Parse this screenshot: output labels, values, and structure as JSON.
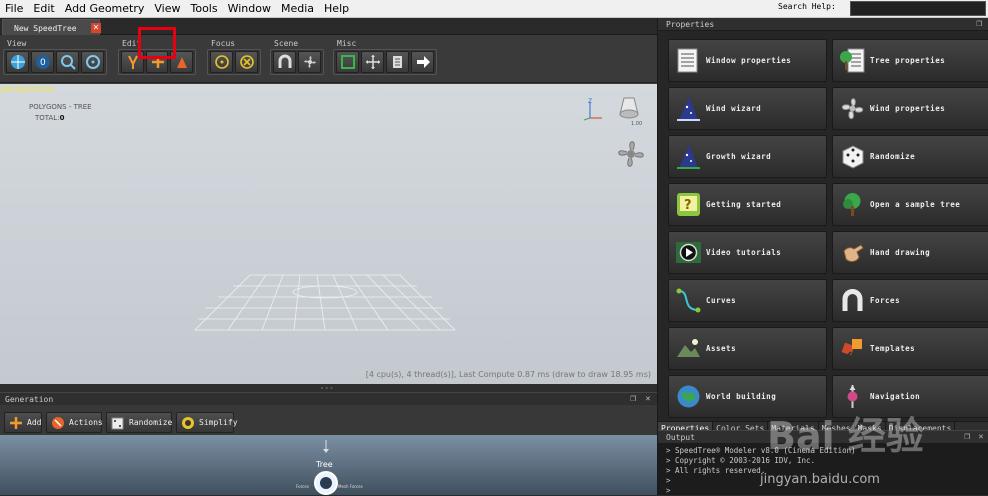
{
  "menu": [
    "File",
    "Edit",
    "Add Geometry",
    "View",
    "Tools",
    "Window",
    "Media",
    "Help"
  ],
  "search_help": {
    "label": "Search Help:",
    "value": ""
  },
  "document_tab": {
    "title": "New SpeedTree",
    "close": "✕"
  },
  "toolbar": {
    "groups": [
      {
        "label": "View",
        "buttons": [
          "globe-icon",
          "zero-icon",
          "zoom-icon",
          "target-icon"
        ]
      },
      {
        "label": "Edit",
        "buttons": [
          "fork-icon",
          "plus-icon",
          "flag-icon"
        ]
      },
      {
        "label": "Focus",
        "buttons": [
          "focus-circle-icon",
          "focus-x-icon"
        ]
      },
      {
        "label": "Scene",
        "buttons": [
          "magnet-icon",
          "fan-icon"
        ]
      },
      {
        "label": "Misc",
        "buttons": [
          "square-icon",
          "move-icon",
          "export-icon",
          "arrow-right-icon"
        ]
      }
    ]
  },
  "viewport": {
    "mode": "perspective",
    "polygons_label": "POLYGONS - TREE",
    "total_label": "TOTAL:",
    "total_value": "0",
    "zoom": "1.00",
    "status": "[4 cpu(s), 4 thread(s)], Last Compute 0.87 ms (draw to draw 18.95 ms)"
  },
  "generation": {
    "title": "Generation",
    "buttons": [
      "Add",
      "Actions",
      "Randomize",
      "Simplify"
    ],
    "tree_label": "Tree",
    "sub_left": "Forces",
    "sub_right": "Mesh Forces"
  },
  "properties": {
    "title": "Properties",
    "tiles": [
      {
        "label": "Window properties",
        "icon": "window-props-icon"
      },
      {
        "label": "Tree properties",
        "icon": "tree-props-icon"
      },
      {
        "label": "Wind wizard",
        "icon": "wizard-hat-icon"
      },
      {
        "label": "Wind properties",
        "icon": "fan-icon"
      },
      {
        "label": "Growth wizard",
        "icon": "wizard-hat-icon"
      },
      {
        "label": "Randomize",
        "icon": "dice-icon"
      },
      {
        "label": "Getting started",
        "icon": "question-icon"
      },
      {
        "label": "Open a sample tree",
        "icon": "sample-tree-icon"
      },
      {
        "label": "Video tutorials",
        "icon": "play-icon"
      },
      {
        "label": "Hand drawing",
        "icon": "hand-icon"
      },
      {
        "label": "Curves",
        "icon": "curve-icon"
      },
      {
        "label": "Forces",
        "icon": "magnet-icon"
      },
      {
        "label": "Assets",
        "icon": "assets-icon"
      },
      {
        "label": "Templates",
        "icon": "template-icon"
      },
      {
        "label": "World building",
        "icon": "world-icon"
      },
      {
        "label": "Navigation",
        "icon": "navigation-icon"
      }
    ],
    "tabs": [
      "Properties",
      "Color Sets",
      "Materials",
      "Meshes",
      "Masks",
      "Displacements"
    ]
  },
  "output": {
    "title": "Output",
    "lines": [
      ">  SpeedTree® Modeler v8.0 (Cinema Edition)",
      ">  Copyright © 2003-2016 IDV, Inc.",
      ">  All rights reserved.",
      ">",
      ">"
    ]
  },
  "watermark": {
    "main": "Bai 经验",
    "url": "jingyan.baidu.com"
  },
  "colors": {
    "highlight": "#e60012",
    "accent": "#f0e24a"
  }
}
